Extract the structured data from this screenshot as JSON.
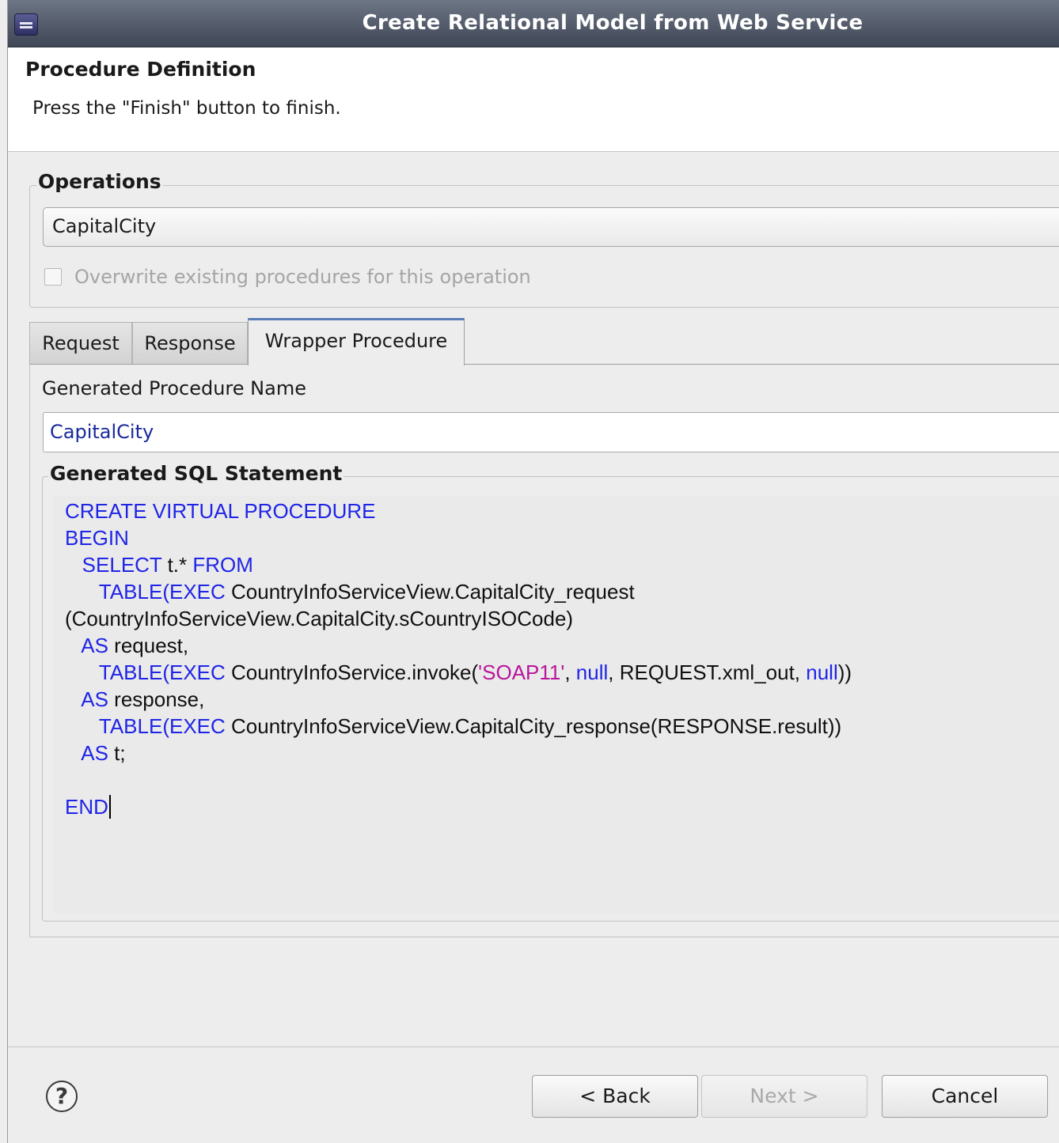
{
  "window": {
    "title": "Create Relational Model from Web Service",
    "icon": "eclipse-app-icon"
  },
  "header": {
    "title": "Procedure Definition",
    "message": "Press the \"Finish\" button to finish."
  },
  "operations": {
    "legend": "Operations",
    "selected": "CapitalCity",
    "overwrite_label": "Overwrite existing procedures for this operation",
    "overwrite_checked": false,
    "overwrite_enabled": false
  },
  "tabs": [
    {
      "label": "Request",
      "active": false
    },
    {
      "label": "Response",
      "active": false
    },
    {
      "label": "Wrapper Procedure",
      "active": true
    }
  ],
  "wrapper": {
    "name_label": "Generated Procedure Name",
    "name_value": "CapitalCity",
    "sql_legend": "Generated SQL Statement",
    "sql_lines": [
      [
        {
          "t": "CREATE VIRTUAL PROCEDURE",
          "c": "kw"
        }
      ],
      [
        {
          "t": "BEGIN",
          "c": "kw"
        }
      ],
      [
        {
          "t": "   "
        },
        {
          "t": "SELECT",
          "c": "kw"
        },
        {
          "t": " t.* "
        },
        {
          "t": "FROM",
          "c": "kw"
        }
      ],
      [
        {
          "t": "      "
        },
        {
          "t": "TABLE(",
          "c": "kw"
        },
        {
          "t": "EXEC",
          "c": "kw"
        },
        {
          "t": " CountryInfoServiceView.CapitalCity_request"
        }
      ],
      [
        {
          "t": "(CountryInfoServiceView.CapitalCity.sCountryISOCode)"
        }
      ],
      [
        {
          "t": "   "
        },
        {
          "t": "AS",
          "c": "kw"
        },
        {
          "t": " request,"
        }
      ],
      [
        {
          "t": "      "
        },
        {
          "t": "TABLE(",
          "c": "kw"
        },
        {
          "t": "EXEC",
          "c": "kw"
        },
        {
          "t": " CountryInfoService.invoke("
        },
        {
          "t": "'SOAP11'",
          "c": "str"
        },
        {
          "t": ", "
        },
        {
          "t": "null",
          "c": "kw"
        },
        {
          "t": ", REQUEST.xml_out, "
        },
        {
          "t": "null",
          "c": "kw"
        },
        {
          "t": "))"
        }
      ],
      [
        {
          "t": "   "
        },
        {
          "t": "AS",
          "c": "kw"
        },
        {
          "t": " response,"
        }
      ],
      [
        {
          "t": "      "
        },
        {
          "t": "TABLE(",
          "c": "kw"
        },
        {
          "t": "EXEC",
          "c": "kw"
        },
        {
          "t": " CountryInfoServiceView.CapitalCity_response(RESPONSE.result))"
        }
      ],
      [
        {
          "t": "   "
        },
        {
          "t": "AS",
          "c": "kw"
        },
        {
          "t": " t;"
        }
      ],
      [],
      [
        {
          "t": "END",
          "c": "kw"
        }
      ]
    ]
  },
  "footer": {
    "help_icon": "question-mark-icon",
    "help_glyph": "?",
    "back_label": "< Back",
    "next_label": "Next >",
    "next_enabled": false,
    "cancel_label": "Cancel"
  },
  "colors": {
    "keyword": "#1f25e6",
    "string": "#b8169b",
    "identifier": "#1a2a9c",
    "active_tab_accent": "#5a7fb8"
  }
}
